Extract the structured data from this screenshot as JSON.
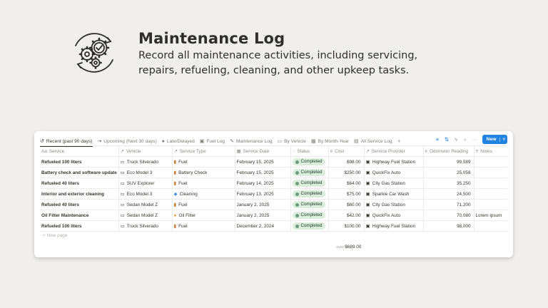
{
  "header": {
    "title": "Maintenance Log",
    "description": "Record all maintenance activities, including servicing, repairs, refueling, cleaning, and other upkeep tasks."
  },
  "tabs": [
    {
      "icon": "↺",
      "label": "Recent (past 90 days)",
      "icon_name": "history-icon"
    },
    {
      "icon": "⇥",
      "label": "Upcoming (Next 30 days)",
      "icon_name": "arrow-right-icon"
    },
    {
      "icon": "●",
      "label": "Late/Delayed",
      "icon_name": "alert-icon"
    },
    {
      "icon": "▣",
      "label": "Fuel Log",
      "icon_name": "fuel-pump-icon"
    },
    {
      "icon": "✎",
      "label": "Maintenance Log",
      "icon_name": "wrench-icon"
    },
    {
      "icon": "▭",
      "label": "By Vehicle",
      "icon_name": "car-icon"
    },
    {
      "icon": "▦",
      "label": "By Month-Year",
      "icon_name": "calendar-icon"
    },
    {
      "icon": "▤",
      "label": "All Service Log",
      "icon_name": "table-icon"
    }
  ],
  "tab_add": "+",
  "toolbar": {
    "filter_icon": "≡",
    "sort_icon": "⇅",
    "automation_icon": "ϟ",
    "search_icon": "⌕",
    "more_icon": "···",
    "new_label": "New",
    "new_dropdown_icon": "˅"
  },
  "columns": [
    {
      "icon": "Aa",
      "label": "Service"
    },
    {
      "icon": "↗",
      "label": "Vehicle"
    },
    {
      "icon": "↗",
      "label": "Service Type"
    },
    {
      "icon": "▦",
      "label": "Service Date"
    },
    {
      "icon": "◌",
      "label": "Status"
    },
    {
      "icon": "#",
      "label": "Cost"
    },
    {
      "icon": "↗",
      "label": "Service Provider"
    },
    {
      "icon": "#",
      "label": "Odometer Reading"
    },
    {
      "icon": "≡",
      "label": "Notes"
    }
  ],
  "rows": [
    {
      "service": "Refueled 100 liters",
      "vehicle": "Truck Silverado",
      "type_icon": "▮",
      "type": "Fuel",
      "date": "February 15, 2025",
      "status": "Completed",
      "cost": "$98.00",
      "provider": "Highway Fuel Station",
      "odometer": "99,589",
      "notes": ""
    },
    {
      "service": "Battery check and software update",
      "vehicle": "Eco Model 3",
      "type_icon": "▮",
      "type": "Battery Check",
      "date": "February 15, 2025",
      "status": "Completed",
      "cost": "$250.00",
      "provider": "QuickFix Auto",
      "odometer": "25,058",
      "notes": ""
    },
    {
      "service": "Refueled 40 liters",
      "vehicle": "SUV Explorer",
      "type_icon": "▮",
      "type": "Fuel",
      "date": "February 14, 2025",
      "status": "Completed",
      "cost": "$64.00",
      "provider": "City Gas Station",
      "odometer": "35,250",
      "notes": ""
    },
    {
      "service": "Interior and exterior cleaning",
      "vehicle": "Eco Model 3",
      "type_icon": "◆",
      "type": "Cleaning",
      "date": "February 13, 2025",
      "status": "Completed",
      "cost": "$75.00",
      "provider": "Sparkle Car Wash",
      "odometer": "24,500",
      "notes": ""
    },
    {
      "service": "Refueled 40 liters",
      "vehicle": "Sedan Model Z",
      "type_icon": "▮",
      "type": "Fuel",
      "date": "January 2, 2025",
      "status": "Completed",
      "cost": "$60.00",
      "provider": "City Gas Station",
      "odometer": "71,200",
      "notes": ""
    },
    {
      "service": "Oil Filter Maintenance",
      "vehicle": "Sedan Model Z",
      "type_icon": "●",
      "type": "Oil Filter",
      "date": "January 2, 2025",
      "status": "Completed",
      "cost": "$42.00",
      "provider": "QuickFix Auto",
      "odometer": "70,080",
      "notes": "Lorem ipsum"
    },
    {
      "service": "Refueled 100 liters",
      "vehicle": "Truck Silverado",
      "type_icon": "▮",
      "type": "Fuel",
      "date": "December 2, 2024",
      "status": "Completed",
      "cost": "$100.00",
      "provider": "Highway Fuel Station",
      "odometer": "98,000",
      "notes": ""
    }
  ],
  "new_page_label": "+ New page",
  "sum": {
    "label": "SUM",
    "value": "$689.00"
  },
  "colors": {
    "accent": "#2383e2",
    "status_bg": "#dbeddb",
    "status_dot": "#6c9b7d",
    "background": "#f0efed"
  }
}
